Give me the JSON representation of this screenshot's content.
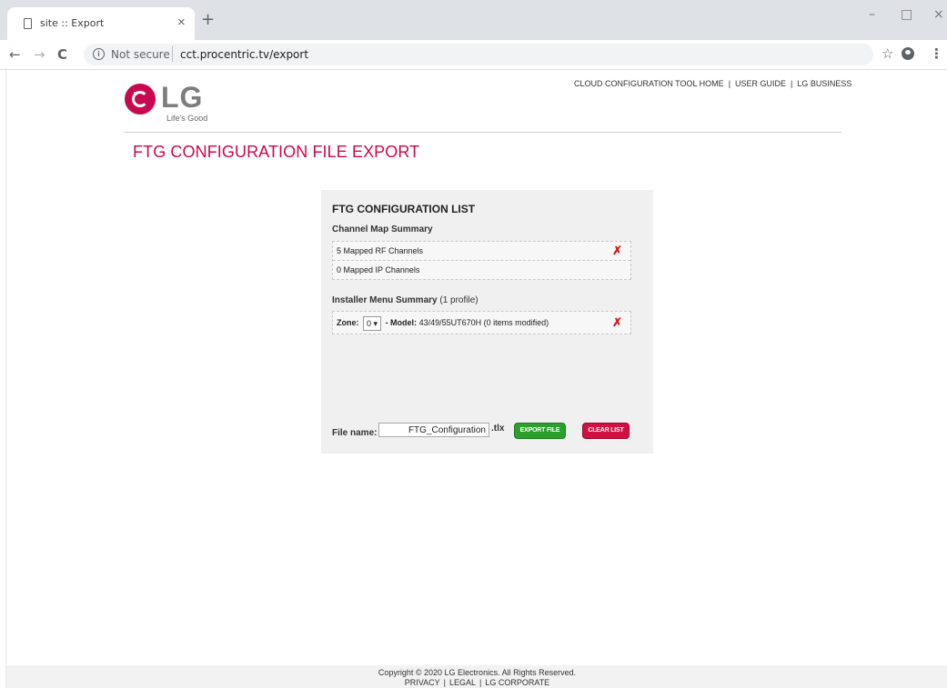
{
  "browser": {
    "tab_title": "site :: Export",
    "tab_close": "×",
    "new_tab": "+",
    "not_secure": "Not secure",
    "url": "cct.procentric.tv/export",
    "back": "←",
    "forward": "→",
    "reload": "C",
    "minimize": "–",
    "maximize": "□",
    "close": "×",
    "star": "☆",
    "menu": "⋮"
  },
  "header": {
    "logo_text": "LG",
    "tagline": "Life's Good",
    "links": [
      "CLOUD CONFIGURATION TOOL HOME",
      "USER GUIDE",
      "LG BUSINESS"
    ],
    "separator": "|"
  },
  "page_title": "FTG CONFIGURATION FILE EXPORT",
  "panel": {
    "title": "FTG CONFIGURATION LIST",
    "channel_map": {
      "label": "Channel Map Summary",
      "rows": [
        "5 Mapped RF Channels",
        "0 Mapped IP Channels"
      ]
    },
    "installer_menu": {
      "label": "Installer Menu Summary",
      "note": "(1 profile)",
      "zone_label": "Zone:",
      "zone_value": "0 ▾",
      "model_label": "- Model:",
      "model_value": "43/49/55UT670H (0 items modified)"
    },
    "delete_icon": "✗",
    "file": {
      "label": "File name:",
      "value": "FTG_Configuration",
      "extension": ".tlx"
    },
    "export_button": "EXPORT FILE",
    "clear_button": "CLEAR LIST"
  },
  "footer": {
    "copyright": "Copyright © 2020 LG Electronics. All Rights Reserved.",
    "links": [
      "PRIVACY",
      "LEGAL",
      "LG CORPORATE"
    ],
    "separator": "|"
  },
  "colors": {
    "brand": "#c8094f",
    "export": "#2ca02c",
    "clear": "#d01040",
    "delete": "#d4141c"
  }
}
